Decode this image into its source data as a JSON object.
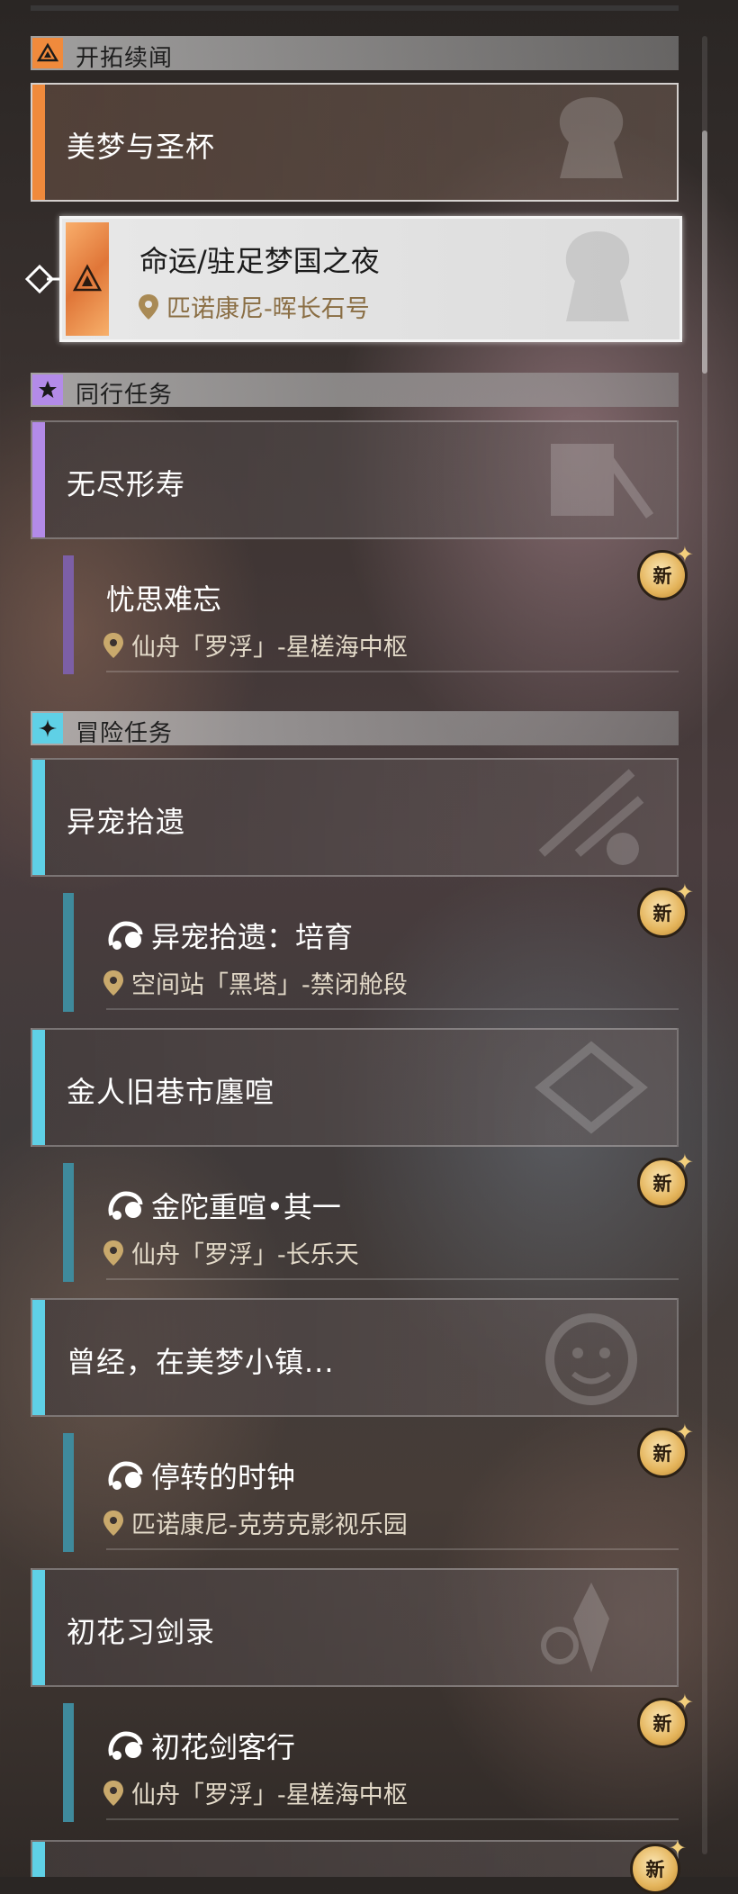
{
  "sections": {
    "trailblaze": {
      "title": "开拓续闻",
      "color": "#f08a3c"
    },
    "companion": {
      "title": "同行任务",
      "color": "#b38be8"
    },
    "adventure": {
      "title": "冒险任务",
      "color": "#5fd0e6"
    }
  },
  "quests": {
    "q1": {
      "name": "美梦与圣杯"
    },
    "q2": {
      "name": "无尽形寿"
    },
    "q3": {
      "name": "异宠拾遗"
    },
    "q4": {
      "name": "金人旧巷市廛喧"
    },
    "q5": {
      "name": "曾经，在美梦小镇..."
    },
    "q6": {
      "name": "初花习剑录"
    }
  },
  "subs": {
    "s1": {
      "name": "命运/驻足梦国之夜",
      "location": "匹诺康尼-晖长石号"
    },
    "s2": {
      "name": "忧思难忘",
      "location": "仙舟「罗浮」-星槎海中枢"
    },
    "s3": {
      "name": "异宠拾遗：培育",
      "location": "空间站「黑塔」-禁闭舱段"
    },
    "s4": {
      "name": "金陀重喧•其一",
      "location": "仙舟「罗浮」-长乐天"
    },
    "s5": {
      "name": "停转的时钟",
      "location": "匹诺康尼-克劳克影视乐园"
    },
    "s6": {
      "name": "初花剑客行",
      "location": "仙舟「罗浮」-星槎海中枢"
    }
  },
  "badges": {
    "new": "新"
  },
  "icons": {
    "section": [
      "trailblaze-icon",
      "star-icon",
      "sparkle-icon"
    ],
    "location": "map-pin-icon",
    "daily": "daily-quest-icon"
  }
}
